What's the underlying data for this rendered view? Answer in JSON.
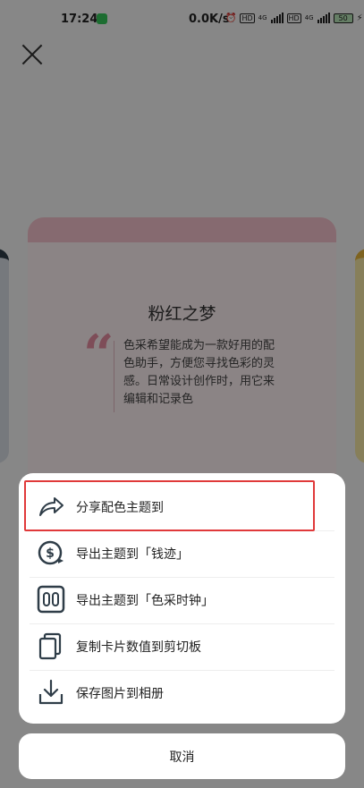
{
  "status_bar": {
    "time": "17:24",
    "network_speed": "0.0K/s",
    "hd1": "HD",
    "hd2": "HD",
    "net1": "4G",
    "net2": "4G",
    "battery": "50"
  },
  "background": {
    "theme_title": "粉红之梦",
    "theme_description": "色采希望能成为一款好用的配色助手，方便您寻找色彩的灵感。日常设计创作时，用它来编辑和记录色",
    "quote_glyph": "“",
    "colors": {
      "card_band": "#f4c2cc",
      "card_body": "#fdf0f2",
      "quote": "#e58da0"
    }
  },
  "sheet": {
    "items": [
      {
        "label": "分享配色主题到",
        "icon": "share-arrow-icon"
      },
      {
        "label": "导出主题到「钱迹」",
        "icon": "money-export-icon"
      },
      {
        "label": "导出主题到「色采时钟」",
        "icon": "clock-00-icon"
      },
      {
        "label": "复制卡片数值到剪切板",
        "icon": "copy-icon"
      },
      {
        "label": "保存图片到相册",
        "icon": "download-icon"
      }
    ],
    "highlight_color": "#e0393a"
  },
  "cancel": {
    "label": "取消"
  }
}
